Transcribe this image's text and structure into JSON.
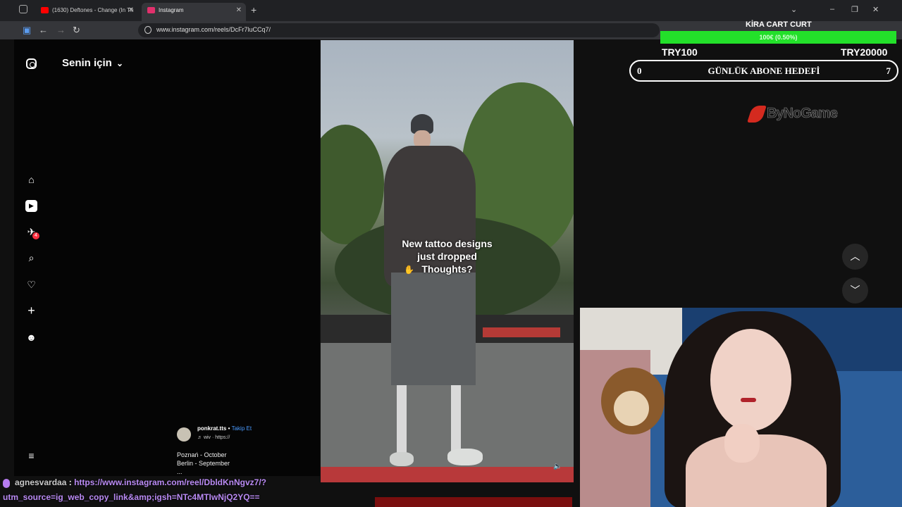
{
  "browser": {
    "tabs": [
      {
        "title": "(1630) Deftones - Change (In Th",
        "favicon": "youtube-icon",
        "color": "#ff0000"
      },
      {
        "title": "Instagram",
        "favicon": "instagram-icon",
        "color": "#e1306c"
      }
    ],
    "new_tab": "+",
    "url": "www.instagram.com/reels/DcFr7luCCq7/"
  },
  "instagram": {
    "feed_title": "Senin için",
    "feed_dropdown": "⌄",
    "sidebar": [
      {
        "name": "home-icon",
        "glyph": "⌂"
      },
      {
        "name": "reels-icon",
        "glyph": "▶"
      },
      {
        "name": "messages-icon",
        "glyph": "✈"
      },
      {
        "name": "search-icon",
        "glyph": "⌕"
      },
      {
        "name": "notifications-icon",
        "glyph": "♡"
      },
      {
        "name": "create-icon",
        "glyph": "+"
      },
      {
        "name": "profile-avatar",
        "glyph": "☻"
      }
    ],
    "messages_badge": "4",
    "more_menu": "≡",
    "reel": {
      "caption_lines": [
        "New tattoo designs",
        "just dropped",
        "Thoughts?"
      ],
      "author": "ponkrat.tts",
      "separator": " • ",
      "follow_label": "Takip Et",
      "music": "♬ wiv · https://",
      "description_lines": [
        "Poznań - October",
        "Berlin - September",
        "..."
      ]
    },
    "nav": {
      "up": "︿",
      "down": "﹀"
    }
  },
  "stream_overlay": {
    "goal_title": "KİRA CART CURT",
    "goal_percent": "100€ (0.50%)",
    "goal_fill": 1.0,
    "goal_min": "TRY100",
    "goal_max": "TRY20000",
    "sub_goal_current": "0",
    "sub_goal_label": "GÜNLÜK ABONE HEDEFİ",
    "sub_goal_target": "7",
    "brand": "ByNoGame"
  },
  "chat": {
    "username": "agnesvardaa",
    "separator": " : ",
    "message_line1": "https://www.instagram.com/reel/DbldKnNgvz7/?",
    "message_line2": "utm_source=ig_web_copy_link&amp;igsh=NTc4MTIwNjQ2YQ=="
  }
}
